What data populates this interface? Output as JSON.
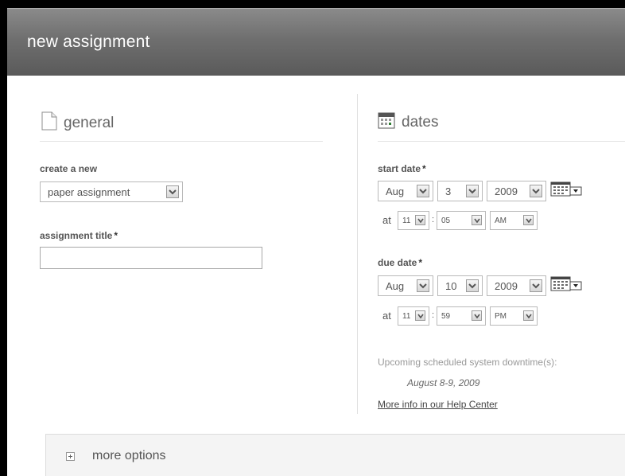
{
  "header": {
    "title": "new assignment"
  },
  "general": {
    "title": "general",
    "icon": "document-icon",
    "create_label": "create a new",
    "create_value": "paper assignment",
    "assignment_title_label": "assignment title",
    "required_mark": "*",
    "assignment_title_value": ""
  },
  "dates": {
    "title": "dates",
    "icon": "calendar-icon",
    "start": {
      "label": "start date",
      "month": "Aug",
      "day": "3",
      "year": "2009",
      "at": "at",
      "hour": "11",
      "colon": ":",
      "minute": "05",
      "ampm": "AM"
    },
    "due": {
      "label": "due date",
      "month": "Aug",
      "day": "10",
      "year": "2009",
      "at": "at",
      "hour": "11",
      "colon": ":",
      "minute": "59",
      "ampm": "PM"
    },
    "downtime_heading": "Upcoming scheduled system downtime(s):",
    "downtime_date": "August 8-9, 2009",
    "help_link": "More info in our Help Center"
  },
  "more_options": {
    "label": "more options",
    "icon": "expand-plus-icon"
  },
  "colors": {
    "header_bg": "#6f6f6f",
    "panel_bg": "#f4f4f4"
  }
}
